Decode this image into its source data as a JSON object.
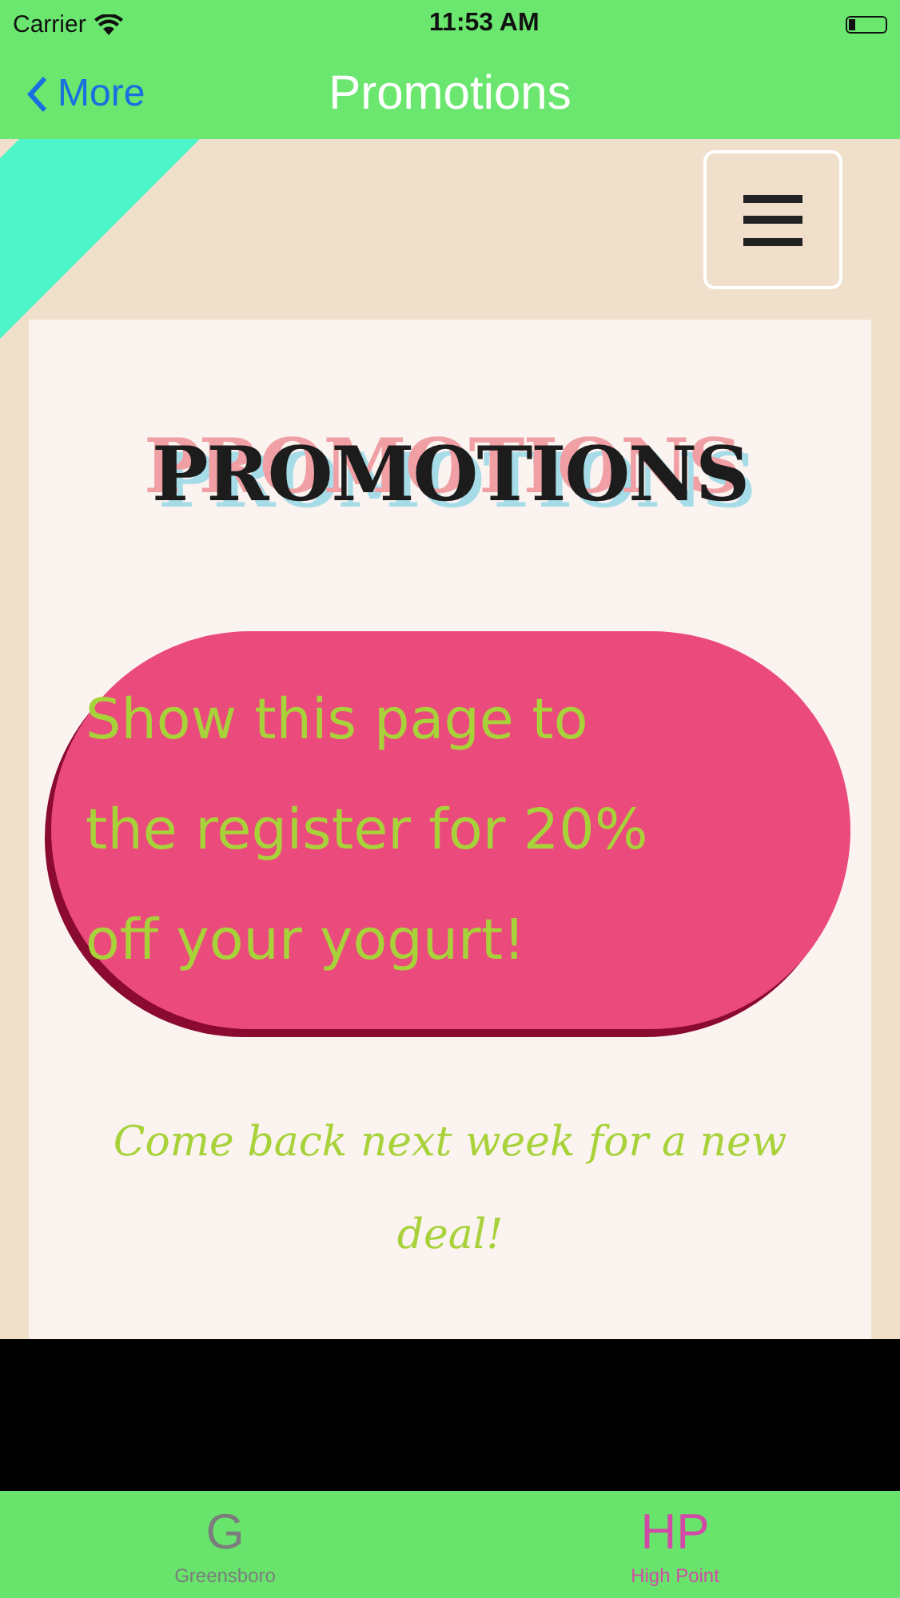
{
  "status_bar": {
    "carrier": "Carrier",
    "time": "11:53 AM"
  },
  "nav_bar": {
    "back_label": "More",
    "title": "Promotions"
  },
  "card": {
    "heading": "PROMOTIONS",
    "offer_lines": [
      "Show this page to",
      "the register for 20%",
      "off your yogurt!"
    ],
    "note": "Come back next week for a new deal!"
  },
  "tab_bar": [
    {
      "glyph": "G",
      "label": "Greensboro",
      "selected": false
    },
    {
      "glyph": "HP",
      "label": "High Point",
      "selected": true
    }
  ]
}
